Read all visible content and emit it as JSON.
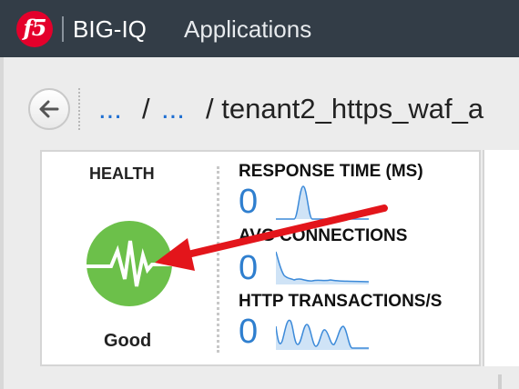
{
  "header": {
    "logo_text": "f5",
    "product_name": "BIG-IQ",
    "section_title": "Applications"
  },
  "breadcrumb": {
    "items": [
      "...",
      "/",
      "...",
      "/ tenant2_https_waf_a"
    ]
  },
  "health": {
    "title": "HEALTH",
    "status": "Good",
    "color": "#6cc04a"
  },
  "metrics": [
    {
      "label": "RESPONSE TIME (MS)",
      "value": "0"
    },
    {
      "label": "AVG CONNECTIONS",
      "value": "0"
    },
    {
      "label": "HTTP TRANSACTIONS/S",
      "value": "0"
    }
  ],
  "colors": {
    "topbar": "#333d47",
    "link": "#1f6fd2",
    "accent_value": "#2f7fcf",
    "annotation_arrow": "#e3151b"
  },
  "icons": [
    "back-arrow-icon",
    "health-pulse-icon"
  ]
}
